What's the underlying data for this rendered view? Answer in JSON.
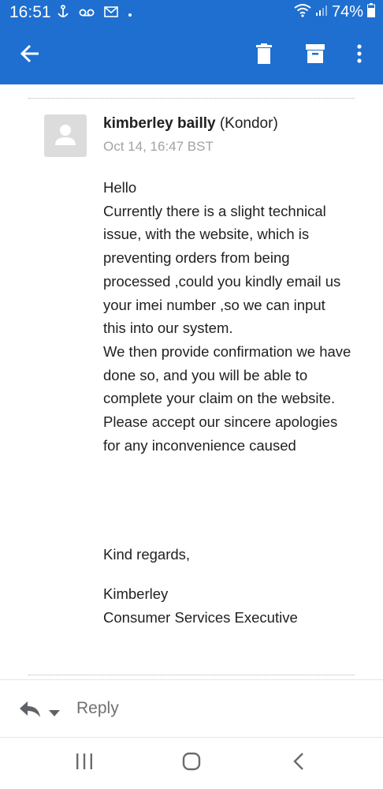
{
  "status_bar": {
    "time": "16:51",
    "battery": "74%"
  },
  "app_bar": {
    "back_icon": "arrow-left-icon",
    "actions": [
      "delete-icon",
      "archive-icon",
      "more-vert-icon"
    ]
  },
  "message": {
    "sender_name": "kimberley bailly",
    "sender_org": "(Kondor)",
    "timestamp": "Oct 14, 16:47 BST",
    "body_lines": [
      "Hello",
      "Currently there is a slight technical",
      "issue, with the website, which is",
      "preventing orders from being",
      "processed ,could you kindly email us",
      "your imei number ,so we can input",
      "this into our system.",
      "We then provide confirmation we have",
      "done so, and you will be able to",
      "complete your claim on the website.",
      "Please accept our sincere apologies",
      "for any inconvenience caused"
    ],
    "signoff": "Kind regards,",
    "signature_name": "Kimberley",
    "signature_title": "Consumer Services Executive"
  },
  "reply_bar": {
    "label": "Reply"
  },
  "colors": {
    "app_bar": "#1e6fcf",
    "text": "#202124",
    "muted": "#a3a3a3"
  }
}
